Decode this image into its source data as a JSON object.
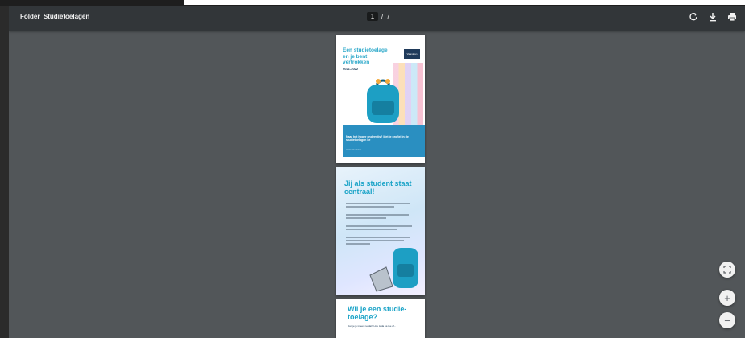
{
  "document": {
    "title": "Folder_Studietoelagen"
  },
  "pager": {
    "current": "1",
    "separator": "/",
    "total": "7"
  },
  "toolbar": {
    "rotate_icon": "rotate-icon",
    "download_icon": "download-icon",
    "print_icon": "print-icon"
  },
  "page1": {
    "heading": "Een studietoelage en je bent vertrokken",
    "year": "2021-2022",
    "logo_text": "Vlaanderen",
    "subtitle": "Naar het hoger onderwijs? Met je profiel in de studietoelagen ke",
    "footer": "www.studietoe"
  },
  "page2": {
    "heading": "Jij als student staat centraal!"
  },
  "page3": {
    "heading": "Wil je een studie-toelage?",
    "text": "Dan je je in een ne dat? Hoe is da na toe of..."
  },
  "fab": {
    "fit_icon": "fit-page-icon",
    "zoom_in": "+",
    "zoom_out": "−"
  },
  "colors": {
    "toolbar": "#323639",
    "viewer_bg": "#525659",
    "accent": "#1aa3c7"
  }
}
